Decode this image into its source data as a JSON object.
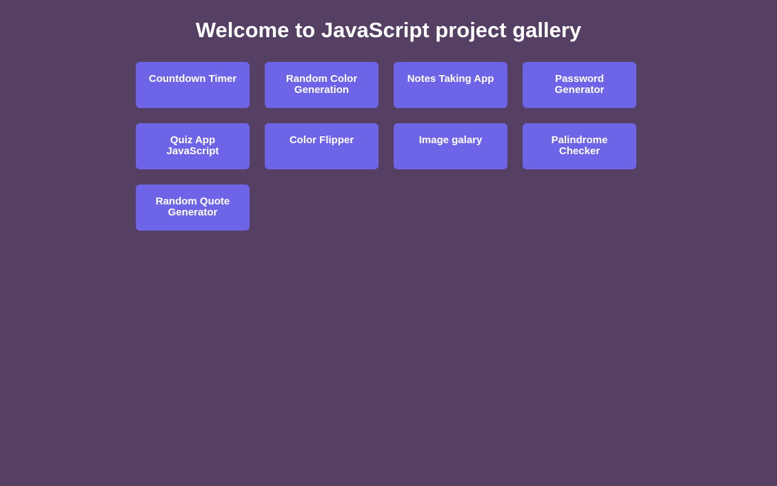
{
  "page": {
    "title": "Welcome to JavaScript project gallery"
  },
  "colors": {
    "background": "#553f63",
    "card": "#6d64e8",
    "text": "#ffffff"
  },
  "projects": [
    {
      "label": "Countdown Timer"
    },
    {
      "label": "Random Color Generation"
    },
    {
      "label": "Notes Taking App"
    },
    {
      "label": "Password Generator"
    },
    {
      "label": "Quiz App JavaScript"
    },
    {
      "label": "Color Flipper"
    },
    {
      "label": "Image galary"
    },
    {
      "label": "Palindrome Checker"
    },
    {
      "label": "Random Quote Generator"
    }
  ]
}
